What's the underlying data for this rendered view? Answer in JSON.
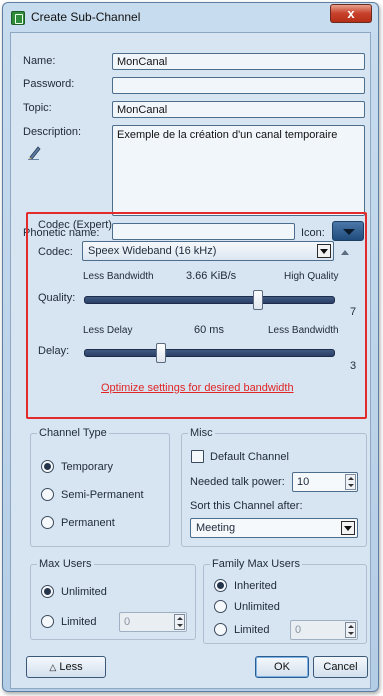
{
  "window": {
    "title": "Create Sub-Channel",
    "close_label": "x"
  },
  "fields": {
    "name_label": "Name:",
    "name_value": "MonCanal",
    "password_label": "Password:",
    "password_value": "",
    "topic_label": "Topic:",
    "topic_value": "MonCanal",
    "description_label": "Description:",
    "description_value": "Exemple de la création d'un canal temporaire",
    "phonetic_label": "Phonetic name:",
    "phonetic_value": "",
    "icon_label": "Icon:"
  },
  "codec": {
    "group_title": "Codec (Expert)",
    "codec_label": "Codec:",
    "codec_value": "Speex Wideband (16 kHz)",
    "quality_label": "Quality:",
    "quality_left": "Less Bandwidth",
    "quality_center": "3.66 KiB/s",
    "quality_right": "High Quality",
    "quality_value": "7",
    "quality_fraction": 0.7,
    "delay_label": "Delay:",
    "delay_left": "Less Delay",
    "delay_center": "60 ms",
    "delay_right": "Less Bandwidth",
    "delay_value": "3",
    "delay_fraction": 0.3,
    "optimize_link": "Optimize settings for desired bandwidth"
  },
  "channel_type": {
    "title": "Channel Type",
    "options": [
      "Temporary",
      "Semi-Permanent",
      "Permanent"
    ],
    "selected": 0
  },
  "misc": {
    "title": "Misc",
    "default_channel_label": "Default Channel",
    "talk_power_label": "Needed talk power:",
    "talk_power_value": "10",
    "sort_label": "Sort this Channel after:",
    "sort_value": "Meeting"
  },
  "max_users": {
    "title": "Max Users",
    "unlimited_label": "Unlimited",
    "limited_label": "Limited",
    "limited_value": "0"
  },
  "family_max_users": {
    "title": "Family Max Users",
    "inherited_label": "Inherited",
    "unlimited_label": "Unlimited",
    "limited_label": "Limited",
    "limited_value": "0"
  },
  "buttons": {
    "less_label": "Less",
    "less_icon": "△",
    "ok_label": "OK",
    "cancel_label": "Cancel"
  }
}
